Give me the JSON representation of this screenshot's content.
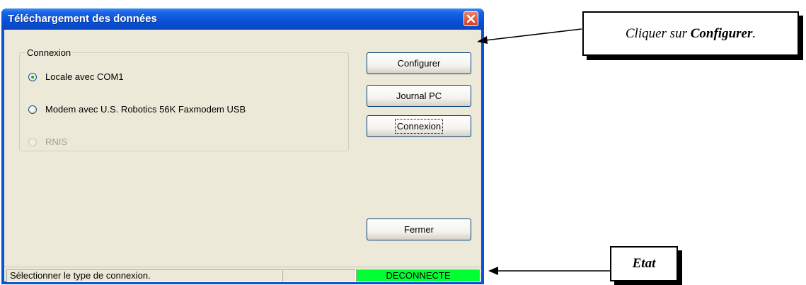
{
  "window": {
    "title": "Téléchargement des données"
  },
  "connection_group": {
    "label": "Connexion",
    "options": [
      {
        "label": "Locale avec COM1",
        "selected": true,
        "enabled": true
      },
      {
        "label": "Modem avec U.S. Robotics 56K Faxmodem USB",
        "selected": false,
        "enabled": true
      },
      {
        "label": "RNIS",
        "selected": false,
        "enabled": false
      }
    ]
  },
  "buttons": {
    "configure": "Configurer",
    "journal": "Journal PC",
    "connect": "Connexion",
    "close": "Fermer"
  },
  "status_bar": {
    "message": "Sélectionner le type de connexion.",
    "middle": "",
    "state": "DECONNECTE",
    "state_color": "#00ff33"
  },
  "annotations": {
    "configure_prefix": "Cliquer sur ",
    "configure_emphasis": "Configurer",
    "configure_suffix": ".",
    "state_label": "Etat"
  },
  "colors": {
    "titlebar": "#0a52d8",
    "dialog_face": "#ece9d8",
    "close_button": "#d3401f"
  },
  "icons": {
    "close": "close-icon",
    "radio": "radio-button",
    "arrow": "arrow-icon"
  }
}
